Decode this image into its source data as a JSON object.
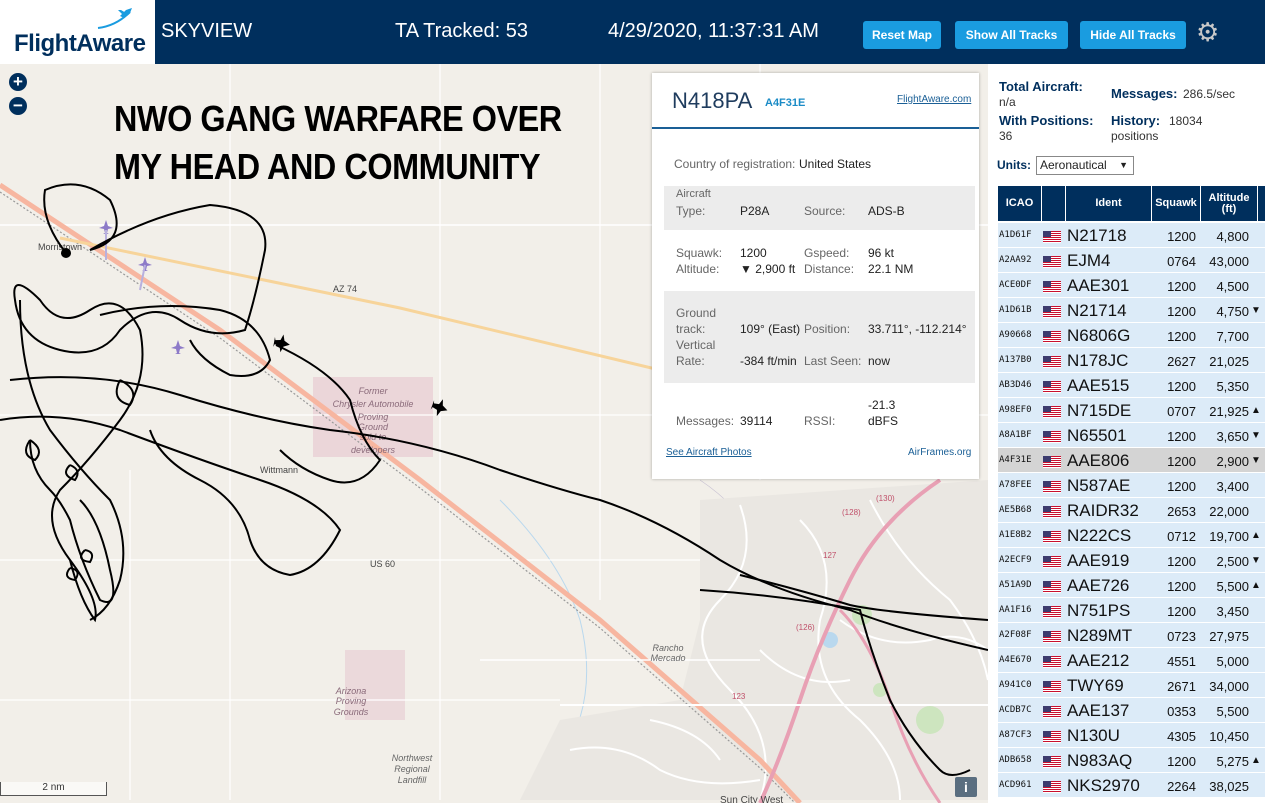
{
  "header": {
    "logo": "FlightAware",
    "app_title": "SKYVIEW",
    "ta_tracked": "TA Tracked: 53",
    "datetime": "4/29/2020, 11:37:31 AM",
    "buttons": {
      "reset_map": "Reset Map",
      "show_all": "Show All Tracks",
      "hide_all": "Hide All Tracks"
    }
  },
  "map": {
    "zoom_in": "+",
    "zoom_out": "−",
    "overlay_line1": "NWO GANG WARFARE OVER",
    "overlay_line2": "MY HEAD AND COMMUNITY",
    "scale": "2 nm",
    "info": "i",
    "labels": {
      "morristown": "Morristown",
      "az74": "AZ 74",
      "us60": "US 60",
      "wittmann": "Wittmann",
      "proving_ground": [
        "Former",
        "Chrysler Automobile",
        "Proving",
        "Ground",
        "sold to",
        "developers"
      ],
      "arizona_pg": [
        "Arizona",
        "Proving",
        "Grounds"
      ],
      "rancho": [
        "Rancho",
        "Mercado"
      ],
      "airport": [
        "Northwest",
        "Regional",
        "Landfill"
      ],
      "sun_city": "Sun City West",
      "road_127": "127",
      "road_123": "123",
      "road_130": "(130)",
      "road_128": "(128)",
      "road_126": "(126)"
    }
  },
  "popup": {
    "ident": "N418PA",
    "icao": "A4F31E",
    "fa_link": "FlightAware.com",
    "country_label": "Country of registration:",
    "country": "United States",
    "aircraft_type_label1": "Aircraft",
    "aircraft_type_label2": "Type:",
    "aircraft_type": "P28A",
    "source_label": "Source:",
    "source": "ADS-B",
    "squawk_label": "Squawk:",
    "squawk": "1200",
    "gspeed_label": "Gspeed:",
    "gspeed": "96 kt",
    "altitude_label": "Altitude:",
    "altitude": "▼ 2,900 ft",
    "distance_label": "Distance:",
    "distance": "22.1 NM",
    "ground_label1": "Ground",
    "ground_label2": "track:",
    "ground_track": "109° (East)",
    "position_label": "Position:",
    "position": "33.711°, -112.214°",
    "vrate_label1": "Vertical",
    "vrate_label2": "Rate:",
    "vrate": "-384 ft/min",
    "lastseen_label": "Last Seen:",
    "lastseen": "now",
    "messages_label": "Messages:",
    "messages": "39114",
    "rssi_label": "RSSI:",
    "rssi1": "-21.3",
    "rssi2": "dBFS",
    "photos_link": "See Aircraft Photos",
    "airframes_link": "AirFrames.org"
  },
  "panel": {
    "total_label": "Total Aircraft:",
    "total_value": "n/a",
    "messages_label": "Messages:",
    "messages_value": "286.5/sec",
    "positions_label": "With Positions:",
    "positions_value": "36",
    "history_label": "History:",
    "history_value1": "18034",
    "history_value2": "positions",
    "units_label": "Units:",
    "units_value": "Aeronautical",
    "columns": {
      "icao": "ICAO",
      "ident": "Ident",
      "squawk": "Squawk",
      "altitude1": "Altitude",
      "altitude2": "(ft)"
    },
    "rows": [
      {
        "icao": "A1D61F",
        "ident": "N21718",
        "squawk": "1200",
        "alt": "4,800",
        "trend": ""
      },
      {
        "icao": "A2AA92",
        "ident": "EJM4",
        "squawk": "0764",
        "alt": "43,000",
        "trend": ""
      },
      {
        "icao": "ACE0DF",
        "ident": "AAE301",
        "squawk": "1200",
        "alt": "4,500",
        "trend": ""
      },
      {
        "icao": "A1D61B",
        "ident": "N21714",
        "squawk": "1200",
        "alt": "4,750",
        "trend": "▼"
      },
      {
        "icao": "A90668",
        "ident": "N6806G",
        "squawk": "1200",
        "alt": "7,700",
        "trend": ""
      },
      {
        "icao": "A137B0",
        "ident": "N178JC",
        "squawk": "2627",
        "alt": "21,025",
        "trend": ""
      },
      {
        "icao": "AB3D46",
        "ident": "AAE515",
        "squawk": "1200",
        "alt": "5,350",
        "trend": ""
      },
      {
        "icao": "A98EF0",
        "ident": "N715DE",
        "squawk": "0707",
        "alt": "21,925",
        "trend": "▲"
      },
      {
        "icao": "A8A1BF",
        "ident": "N65501",
        "squawk": "1200",
        "alt": "3,650",
        "trend": "▼"
      },
      {
        "icao": "A4F31E",
        "ident": "AAE806",
        "squawk": "1200",
        "alt": "2,900",
        "trend": "▼"
      },
      {
        "icao": "A78FEE",
        "ident": "N587AE",
        "squawk": "1200",
        "alt": "3,400",
        "trend": ""
      },
      {
        "icao": "AE5B68",
        "ident": "RAIDR32",
        "squawk": "2653",
        "alt": "22,000",
        "trend": ""
      },
      {
        "icao": "A1E8B2",
        "ident": "N222CS",
        "squawk": "0712",
        "alt": "19,700",
        "trend": "▲"
      },
      {
        "icao": "A2ECF9",
        "ident": "AAE919",
        "squawk": "1200",
        "alt": "2,500",
        "trend": "▼"
      },
      {
        "icao": "A51A9D",
        "ident": "AAE726",
        "squawk": "1200",
        "alt": "5,500",
        "trend": "▲"
      },
      {
        "icao": "AA1F16",
        "ident": "N751PS",
        "squawk": "1200",
        "alt": "3,450",
        "trend": ""
      },
      {
        "icao": "A2F08F",
        "ident": "N289MT",
        "squawk": "0723",
        "alt": "27,975",
        "trend": ""
      },
      {
        "icao": "A4E670",
        "ident": "AAE212",
        "squawk": "4551",
        "alt": "5,000",
        "trend": ""
      },
      {
        "icao": "A941C0",
        "ident": "TWY69",
        "squawk": "2671",
        "alt": "34,000",
        "trend": ""
      },
      {
        "icao": "ACDB7C",
        "ident": "AAE137",
        "squawk": "0353",
        "alt": "5,500",
        "trend": ""
      },
      {
        "icao": "A87CF3",
        "ident": "N130U",
        "squawk": "4305",
        "alt": "10,450",
        "trend": ""
      },
      {
        "icao": "ADB658",
        "ident": "N983AQ",
        "squawk": "1200",
        "alt": "5,275",
        "trend": "▲"
      },
      {
        "icao": "ACD961",
        "ident": "NKS2970",
        "squawk": "2264",
        "alt": "38,025",
        "trend": ""
      }
    ],
    "selected_icao": "A4F31E"
  },
  "colors": {
    "header_bg": "#002f5d",
    "button": "#1a9ce0",
    "row_bg": "#dcebf8",
    "row_selected": "#d4d4d4"
  }
}
